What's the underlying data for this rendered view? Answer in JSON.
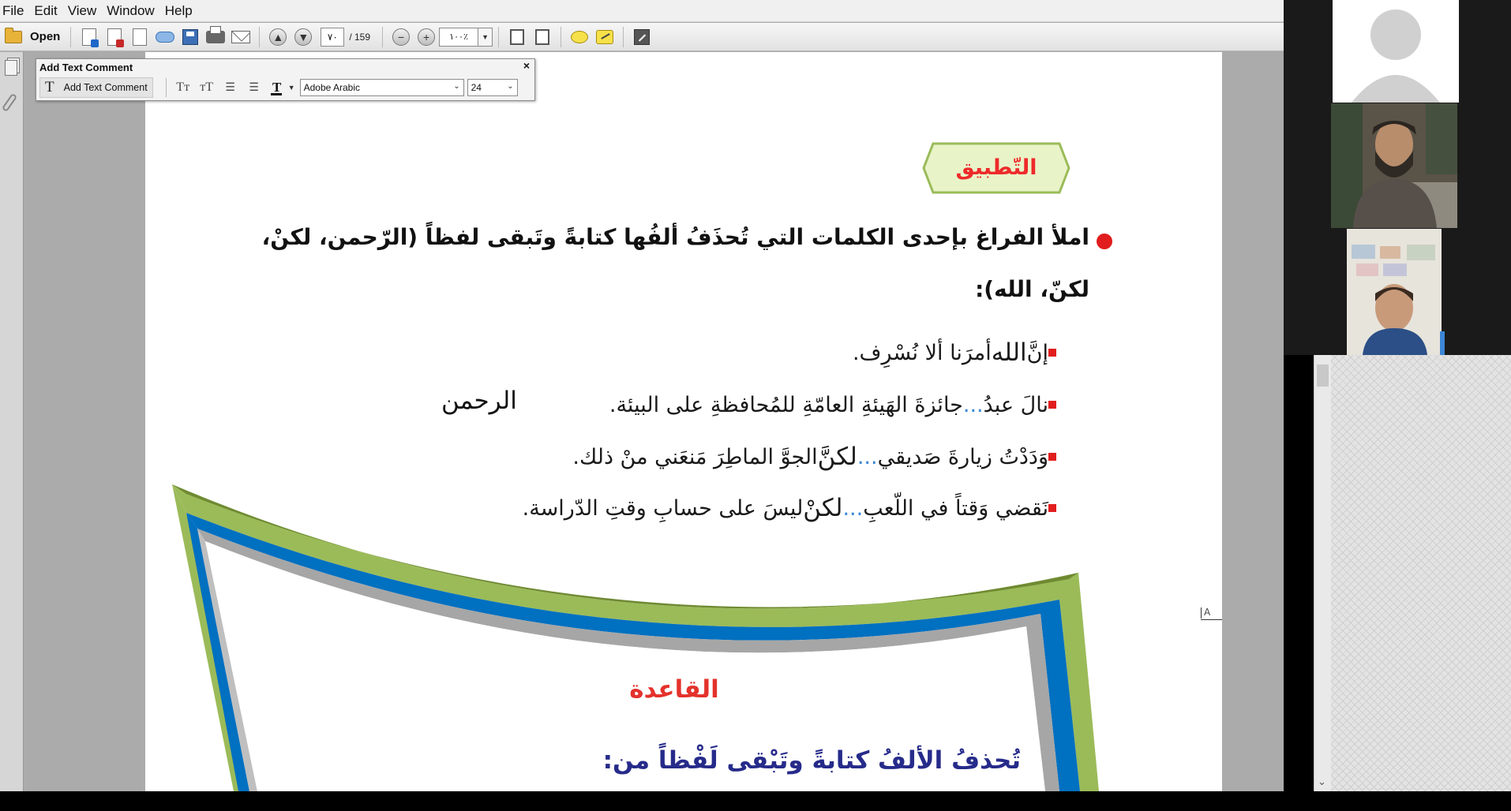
{
  "menu": [
    "File",
    "Edit",
    "View",
    "Window",
    "Help"
  ],
  "toolbar": {
    "open_label": "Open",
    "page_current": "٧٠",
    "page_total": "/ 159",
    "zoom_value": "١٠٠٪"
  },
  "comment_toolbar": {
    "title": "Add Text Comment",
    "close_glyph": "×",
    "add_glyph": "T",
    "add_label": "Add Text Comment",
    "font_name": "Adobe Arabic",
    "font_size": "24"
  },
  "document": {
    "badge": "التّطبيق",
    "instruction_line1": "املأ الفراغ بإحدى الكلمات التي تُحذَفُ ألفُها كتابةً وتَبقى لفظاً (الرّحمن، لكنْ،",
    "instruction_line2": "لكنّ، الله):",
    "exercises": [
      {
        "pre": "إنَّ",
        "dots": "",
        "answer": "الله",
        "post": "أمرَنا ألا نُسْرِف."
      },
      {
        "pre": "نالَ عبدُ",
        "dots": " ... ",
        "answer": "",
        "post": "جائزةَ الهَيئةِ العامّةِ للمُحافظةِ على البيئة."
      },
      {
        "pre": "وَدَدْتُ زيارةَ صَديقي",
        "dots": "...",
        "answer": "لكنَّ",
        "post": "الجوَّ الماطِرَ مَنعَني منْ ذلك."
      },
      {
        "pre": "نَقضي وَقتاً في اللّعبِ",
        "dots": "...",
        "answer": "لكنْ",
        "post": "ليسَ على حسابِ وقتِ الدّراسة."
      }
    ],
    "typed_answer": "الرحمن",
    "cursor_glyph": "A",
    "rule_title": "القاعدة",
    "rule_text": "تُحذفُ الألفُ كتابةً وتَبْقى لَفْظاً من:"
  },
  "colors": {
    "bullet_red": "#e11d1d",
    "badge_fill": "#e9f3c8",
    "badge_stroke": "#9bbb59",
    "frame_green": "#9bbb59",
    "frame_blue": "#0070c0",
    "rule_blue": "#262b8a",
    "rule_title_red": "#e4322c"
  },
  "icons": [
    "folder-icon",
    "pages-icon",
    "attachment-icon",
    "comment-icon",
    "sticky-note-icon",
    "expand-icon"
  ]
}
